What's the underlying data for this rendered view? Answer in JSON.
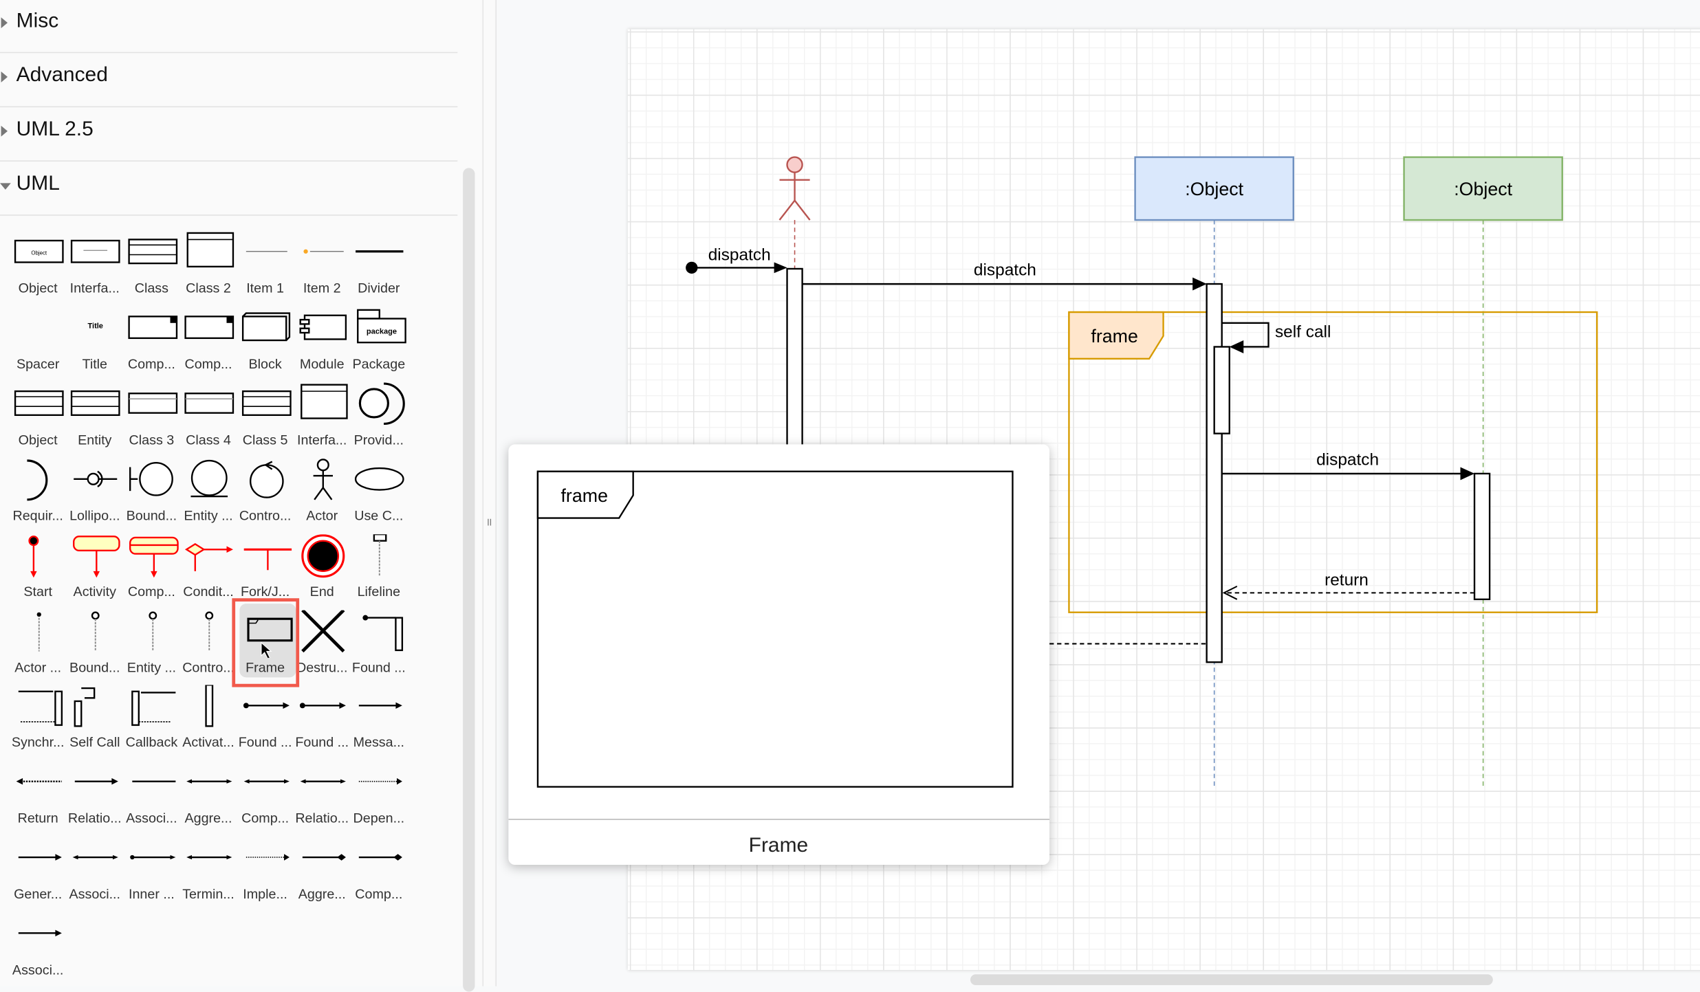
{
  "sidebar": {
    "sections": [
      {
        "label": "Misc",
        "open": false
      },
      {
        "label": "Advanced",
        "open": false
      },
      {
        "label": "UML 2.5",
        "open": false
      },
      {
        "label": "UML",
        "open": true
      }
    ],
    "palette": [
      {
        "label": "Object",
        "icon": "object-box"
      },
      {
        "label": "Interfa...",
        "icon": "interface-box"
      },
      {
        "label": "Class",
        "icon": "class-box"
      },
      {
        "label": "Class 2",
        "icon": "class2-box"
      },
      {
        "label": "Item 1",
        "icon": "item-attribute"
      },
      {
        "label": "Item 2",
        "icon": "item-attribute-icon"
      },
      {
        "label": "Divider",
        "icon": "divider-line"
      },
      {
        "label": "Spacer",
        "icon": "spacer"
      },
      {
        "label": "Title",
        "icon": "title-text"
      },
      {
        "label": "Comp...",
        "icon": "component-box"
      },
      {
        "label": "Comp...",
        "icon": "component-box"
      },
      {
        "label": "Block",
        "icon": "block-3d"
      },
      {
        "label": "Module",
        "icon": "module"
      },
      {
        "label": "Package",
        "icon": "package"
      },
      {
        "label": "Object",
        "icon": "class-box"
      },
      {
        "label": "Entity",
        "icon": "class-box"
      },
      {
        "label": "Class 3",
        "icon": "class3"
      },
      {
        "label": "Class 4",
        "icon": "class3"
      },
      {
        "label": "Class 5",
        "icon": "class-box"
      },
      {
        "label": "Interfa...",
        "icon": "class2-box"
      },
      {
        "label": "Provid...",
        "icon": "provided-interface"
      },
      {
        "label": "Requir...",
        "icon": "required-interface"
      },
      {
        "label": "Lollipo...",
        "icon": "lollipop"
      },
      {
        "label": "Bound...",
        "icon": "boundary-object"
      },
      {
        "label": "Entity ...",
        "icon": "entity-object"
      },
      {
        "label": "Contro...",
        "icon": "control-object"
      },
      {
        "label": "Actor",
        "icon": "actor"
      },
      {
        "label": "Use C...",
        "icon": "use-case"
      },
      {
        "label": "Start",
        "icon": "start-node"
      },
      {
        "label": "Activity",
        "icon": "activity"
      },
      {
        "label": "Comp...",
        "icon": "composite-state"
      },
      {
        "label": "Condit...",
        "icon": "condition"
      },
      {
        "label": "Fork/J...",
        "icon": "fork-join"
      },
      {
        "label": "End",
        "icon": "end-node"
      },
      {
        "label": "Lifeline",
        "icon": "lifeline"
      },
      {
        "label": "Actor ...",
        "icon": "lifeline-actor"
      },
      {
        "label": "Bound...",
        "icon": "lifeline-circle"
      },
      {
        "label": "Entity ...",
        "icon": "lifeline-circle"
      },
      {
        "label": "Contro...",
        "icon": "lifeline-circle"
      },
      {
        "label": "Frame",
        "icon": "frame",
        "selected": true
      },
      {
        "label": "Destru...",
        "icon": "destruction-x"
      },
      {
        "label": "Found ...",
        "icon": "found-activation"
      },
      {
        "label": "Synchr...",
        "icon": "sync-call"
      },
      {
        "label": "Self Call",
        "icon": "self-call"
      },
      {
        "label": "Callback",
        "icon": "callback"
      },
      {
        "label": "Activat...",
        "icon": "activation-bar"
      },
      {
        "label": "Found ...",
        "icon": "found-message"
      },
      {
        "label": "Found ...",
        "icon": "found-message"
      },
      {
        "label": "Messa...",
        "icon": "message-arrow"
      },
      {
        "label": "Return",
        "icon": "return-arrow"
      },
      {
        "label": "Relatio...",
        "icon": "arrow"
      },
      {
        "label": "Associ...",
        "icon": "line"
      },
      {
        "label": "Aggre...",
        "icon": "double-arrow"
      },
      {
        "label": "Comp...",
        "icon": "double-arrow"
      },
      {
        "label": "Relatio...",
        "icon": "double-arrow"
      },
      {
        "label": "Depen...",
        "icon": "dotted-arrow"
      },
      {
        "label": "Gener...",
        "icon": "arrow"
      },
      {
        "label": "Associ...",
        "icon": "double-arrow"
      },
      {
        "label": "Inner ...",
        "icon": "dot-arrow"
      },
      {
        "label": "Termin...",
        "icon": "double-arrow"
      },
      {
        "label": "Imple...",
        "icon": "dotted-arrow"
      },
      {
        "label": "Aggre...",
        "icon": "diamond-arrow"
      },
      {
        "label": "Comp...",
        "icon": "diamond-arrow"
      },
      {
        "label": "Associ...",
        "icon": "arrow"
      }
    ]
  },
  "diagram": {
    "found_label": "dispatch",
    "dispatch1_label": "dispatch",
    "object1_label": ":Object",
    "object2_label": ":Object",
    "frame_label": "frame",
    "self_call_label": "self call",
    "dispatch2_label": "dispatch",
    "return_label": "return"
  },
  "popup": {
    "frame_label": "frame",
    "title": "Frame"
  },
  "colors": {
    "actor_stroke": "#b85450",
    "actor_fill": "#f8cecc",
    "object1_fill": "#dae8fc",
    "object1_stroke": "#6c8ebf",
    "object2_fill": "#d5e8d4",
    "object2_stroke": "#82b366",
    "frame_stroke": "#d79b00",
    "frame_fill": "#ffe6cc",
    "selection": "#f15a4c"
  }
}
